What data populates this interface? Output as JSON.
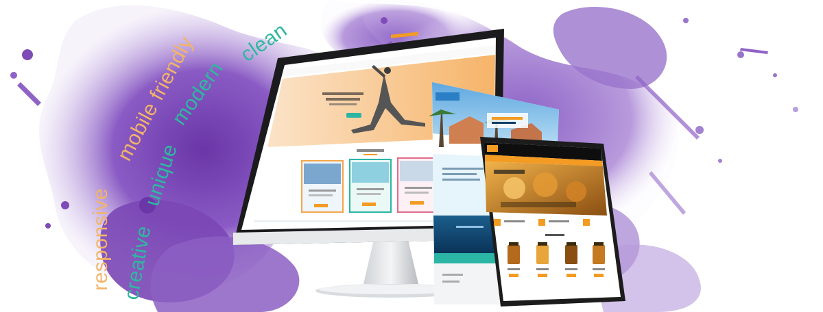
{
  "tagline_words": [
    {
      "id": "responsive",
      "text": "responsive",
      "color": "#f2b468"
    },
    {
      "id": "mobile-friendly",
      "text": "mobile friendly",
      "color": "#f2b468"
    },
    {
      "id": "creative",
      "text": "creative",
      "color": "#2fb8a0"
    },
    {
      "id": "unique",
      "text": "unique",
      "color": "#2fb8a0"
    },
    {
      "id": "modern",
      "text": "modern",
      "color": "#2fb8a0"
    },
    {
      "id": "clean",
      "text": "clean",
      "color": "#2fb8a0"
    }
  ],
  "colors": {
    "paint_purple": "#7e4bb7",
    "paint_light": "#c9b3e3",
    "accent_orange": "#f39b22",
    "teal": "#2bb5a5",
    "navy": "#0f3b66"
  },
  "devices": {
    "monitor": {
      "site": "yoga studio website",
      "icon": "monitor"
    },
    "tablet_back": {
      "site": "resort website",
      "icon": "tablet"
    },
    "tablet_front": {
      "site": "honey shop website",
      "icon": "tablet"
    }
  }
}
